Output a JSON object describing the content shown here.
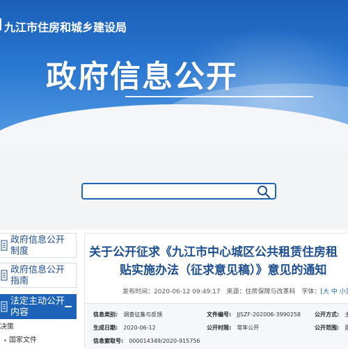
{
  "header": {
    "site_name": "九江市住房和城乡建设局",
    "page_hero": "政府信息公开"
  },
  "search": {
    "placeholder": ""
  },
  "sidebar": {
    "items": [
      {
        "label": "政府信息公开制度",
        "icon": "document-icon",
        "active": false
      },
      {
        "label": "政府信息公开指南",
        "icon": "document-icon",
        "active": false
      },
      {
        "label": "法定主动公开内容",
        "icon": "document-icon",
        "active": true
      }
    ],
    "sub_items": [
      "决策",
      "国家文件"
    ]
  },
  "article": {
    "title_line1": "关于公开征求《九江市中心城区公共租赁住房租",
    "title_line2": "贴实施办法（征求意见稿）》意见的通知",
    "publish_label": "发布时间：",
    "publish_time": "2020-06-12 09:49:17",
    "source_label": "来源：",
    "source": "住房保障与改革科",
    "fontsize_label": "字体：",
    "fontsize_options": "[大 中 小]"
  },
  "info_table": {
    "category_label": "信息类别:",
    "category": "调查征集与反馈",
    "doc_no_label": "文件编号:",
    "doc_no": "JJSZF-202006-3990258",
    "public_method_label": "公开方式:",
    "public_method": "主动",
    "date_label": "生成日期:",
    "date": "2020-06-12",
    "public_time_label": "公开时限:",
    "public_time": "常年公开",
    "scope_label": "公开范围:",
    "scope": "面向",
    "index_label": "信息索取号:",
    "index_no": "000014349/2020-915756"
  },
  "colors": {
    "brand_blue": "#1d64b9",
    "title_blue": "#1d4e8f"
  }
}
